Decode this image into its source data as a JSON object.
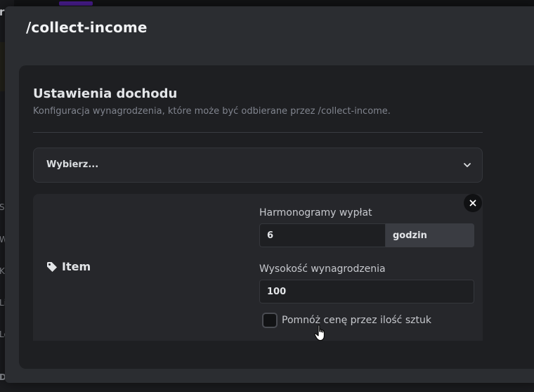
{
  "modal": {
    "title": "/collect-income"
  },
  "card": {
    "title": "Ustawienia dochodu",
    "subtitle": "Konfiguracja wynagrodzenia, które może być odbierane przez /collect-income."
  },
  "select": {
    "value": "Wybierz...",
    "icon": "chevron-down-icon"
  },
  "item": {
    "label": "Item",
    "icon": "tag-icon",
    "close_icon": "close-icon",
    "schedule_label": "Harmonogramy wypłat",
    "schedule_value": "6",
    "schedule_unit": "godzin",
    "amount_label": "Wysokość wynagrodzenia",
    "amount_value": "100",
    "multiply_label": "Pomnóż cenę przez ilość sztuk",
    "multiply_checked": false
  },
  "background": {
    "left_letters": [
      "r",
      "St",
      "W",
      "K",
      "Li",
      "Lo",
      "D"
    ]
  },
  "colors": {
    "page_bg": "#151619",
    "modal_bg": "#2b2d31",
    "card_bg": "#1e1f22",
    "panel_bg": "#26272b",
    "unit_bg": "#3a3c42"
  }
}
